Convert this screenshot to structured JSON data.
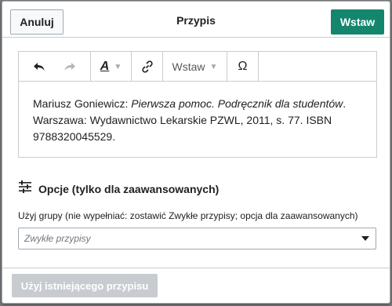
{
  "header": {
    "cancel_label": "Anuluj",
    "title": "Przypis",
    "insert_label": "Wstaw"
  },
  "toolbar": {
    "undo_icon": "undo-icon",
    "redo_icon": "redo-icon",
    "style_icon": "text-style-icon",
    "link_icon": "link-icon",
    "insert_menu_label": "Wstaw",
    "special_char_label": "Ω"
  },
  "editor": {
    "author": "Mariusz Goniewicz: ",
    "title_italic": "Pierwsza pomoc. Podręcznik dla studentów",
    "after_title": ".",
    "line2": "Warszawa: Wydawnictwo Lekarskie PZWL, 2011, s. 77. ISBN",
    "line3": "9788320045529."
  },
  "options": {
    "title": "Opcje (tylko dla zaawansowanych)",
    "group_label": "Użyj grupy (nie wypełniać: zostawić Zwykłe przypisy; opcja dla zaawansowanych)",
    "group_placeholder": "Zwykłe przypisy"
  },
  "footer": {
    "use_existing_label": "Użyj istniejącego przypisu"
  },
  "colors": {
    "primary": "#14866d",
    "disabled": "#c8ccd1",
    "border": "#a2a9b1"
  }
}
